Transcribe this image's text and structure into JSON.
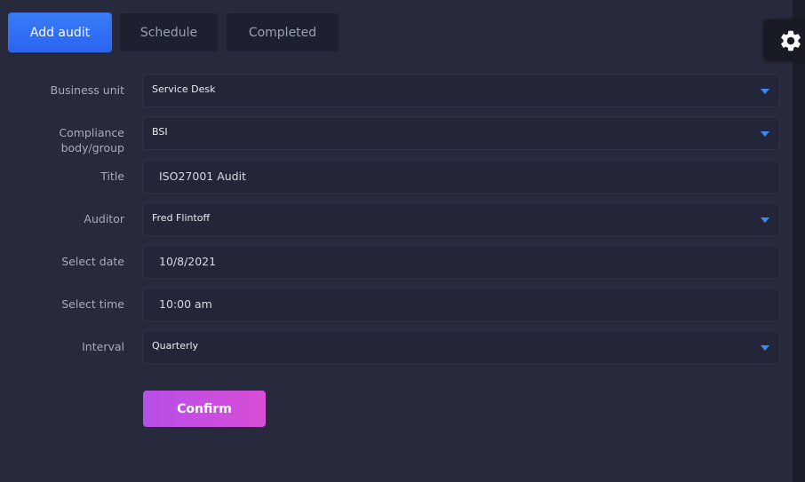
{
  "tabs": {
    "add_audit": "Add audit",
    "schedule": "Schedule",
    "completed": "Completed"
  },
  "settings": {
    "icon": "gear-icon"
  },
  "form": {
    "business_unit": {
      "label": "Business unit",
      "value": "Service Desk"
    },
    "compliance_body": {
      "label_line1": "Compliance",
      "label_line2": "body/group",
      "value": "BSI"
    },
    "title": {
      "label": "Title",
      "value": "ISO27001 Audit"
    },
    "auditor": {
      "label": "Auditor",
      "value": "Fred Flintoff"
    },
    "date": {
      "label": "Select date",
      "value": "10/8/2021"
    },
    "time": {
      "label": "Select time",
      "value": "10:00 am"
    },
    "interval": {
      "label": "Interval",
      "value": "Quarterly"
    }
  },
  "confirm_label": "Confirm",
  "colors": {
    "background": "#272a3c",
    "field": "#232638",
    "accent_blue": "#2a64f2",
    "confirm_gradient_start": "#b64fe8",
    "confirm_gradient_end": "#d94ed6",
    "caret": "#3b8cf0"
  }
}
